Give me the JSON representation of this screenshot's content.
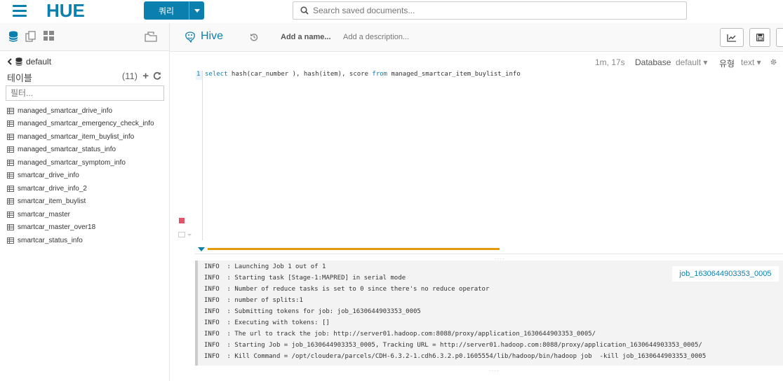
{
  "header": {
    "logo_text": "HUE",
    "query_button": "쿼리",
    "search_placeholder": "Search saved documents..."
  },
  "sidebar": {
    "database": "default",
    "tables_label": "테이블",
    "tables_count": "(11)",
    "filter_placeholder": "필터...",
    "tables": [
      "managed_smartcar_drive_info",
      "managed_smartcar_emergency_check_info",
      "managed_smartcar_item_buylist_info",
      "managed_smartcar_status_info",
      "managed_smartcar_symptom_info",
      "smartcar_drive_info",
      "smartcar_drive_info_2",
      "smartcar_item_buylist",
      "smartcar_master",
      "smartcar_master_over18",
      "smartcar_status_info"
    ]
  },
  "editor": {
    "engine": "Hive",
    "name_placeholder": "Add a name...",
    "description_placeholder": "Add a description...",
    "elapsed": "1m, 17s",
    "database_label": "Database",
    "database_value": "default",
    "type_label": "유형",
    "type_value": "text",
    "line_number": "1",
    "query": {
      "kw_select": "select",
      "expr": " hash(car_number ), hash(item), score ",
      "kw_from": "from",
      "table": " managed_smartcar_item_buylist_info"
    }
  },
  "log": {
    "job_link": "job_1630644903353_0005",
    "lines": [
      "INFO  : Launching Job 1 out of 1",
      "INFO  : Starting task [Stage-1:MAPRED] in serial mode",
      "INFO  : Number of reduce tasks is set to 0 since there's no reduce operator",
      "INFO  : number of splits:1",
      "INFO  : Submitting tokens for job: job_1630644903353_0005",
      "INFO  : Executing with tokens: []",
      "INFO  : The url to track the job: http://server01.hadoop.com:8088/proxy/application_1630644903353_0005/",
      "INFO  : Starting Job = job_1630644903353_0005, Tracking URL = http://server01.hadoop.com:8088/proxy/application_1630644903353_0005/",
      "INFO  : Kill Command = /opt/cloudera/parcels/CDH-6.3.2-1.cdh6.3.2.p0.1605554/lib/hadoop/bin/hadoop job  -kill job_1630644903353_0005"
    ]
  },
  "colors": {
    "brand": "#0B7FAD",
    "progress": "#E59A0B",
    "stop": "#e0556a"
  }
}
